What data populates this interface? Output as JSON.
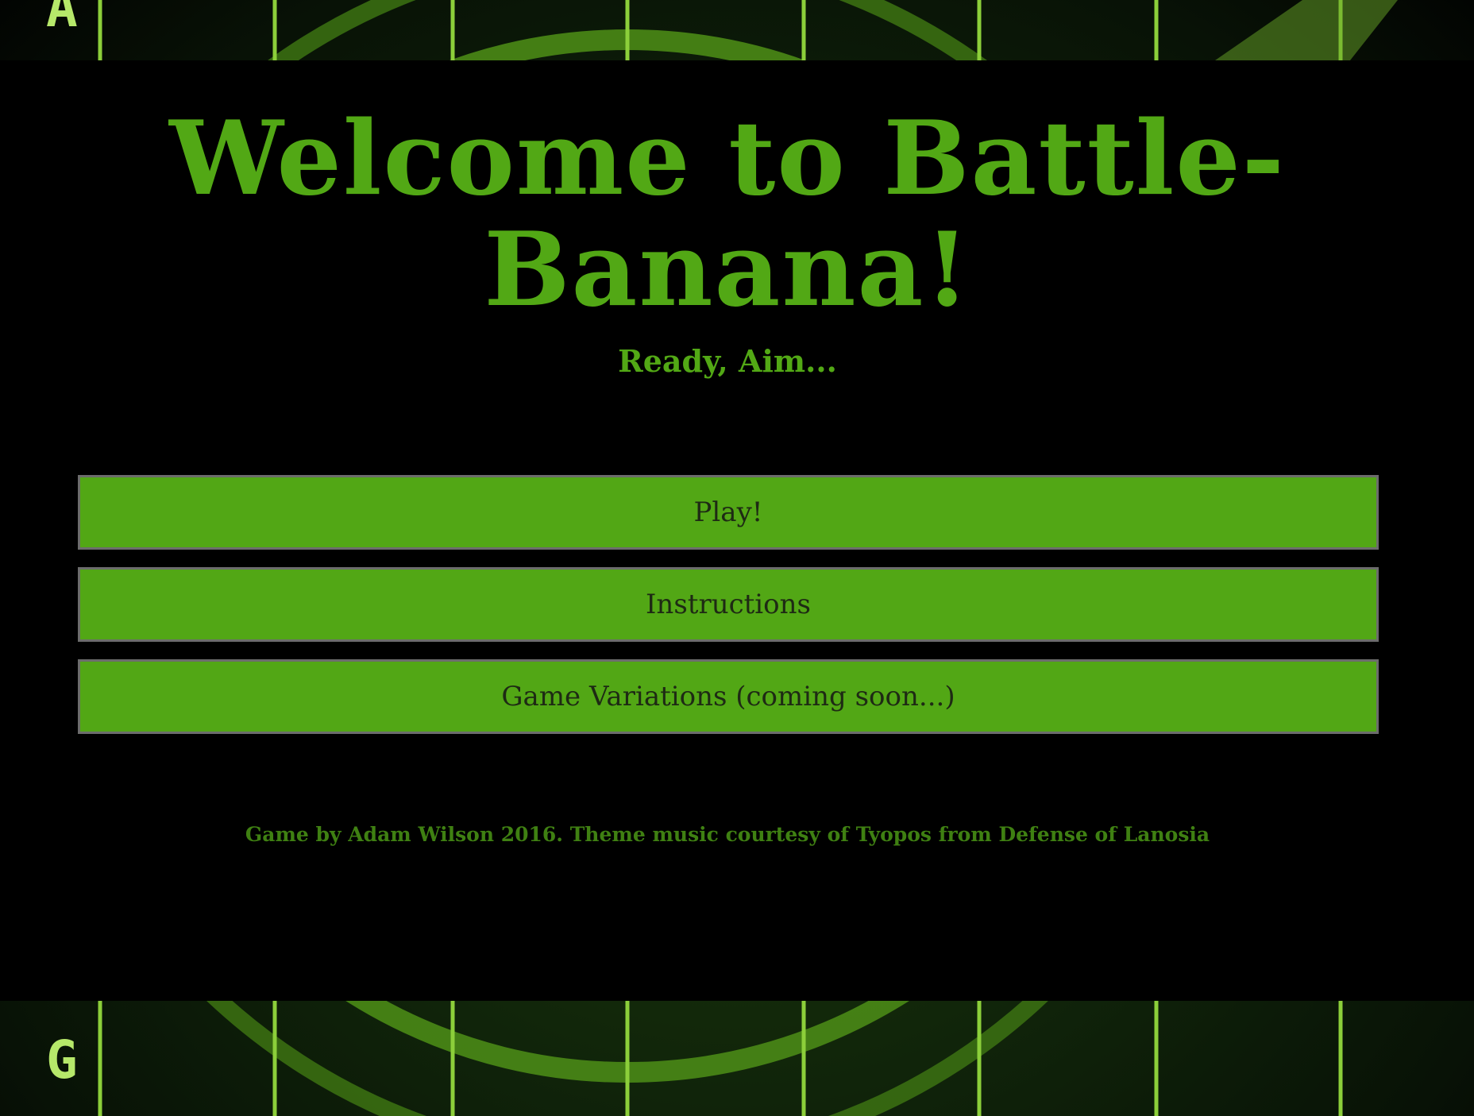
{
  "title": "Welcome to Battle-Banana!",
  "subtitle": "Ready, Aim...",
  "buttons": {
    "play": "Play!",
    "instructions": "Instructions",
    "variations": "Game Variations (coming soon...)"
  },
  "footer": "Game by Adam Wilson 2016. Theme music courtesy of Tyopos from Defense of Lanosia",
  "background": {
    "grid_letters": [
      "A",
      "G"
    ]
  },
  "colors": {
    "accent": "#52a815",
    "button": "#52a715",
    "button_border": "#6c6c6c",
    "button_text": "#1e2a14",
    "panel": "#000000"
  }
}
